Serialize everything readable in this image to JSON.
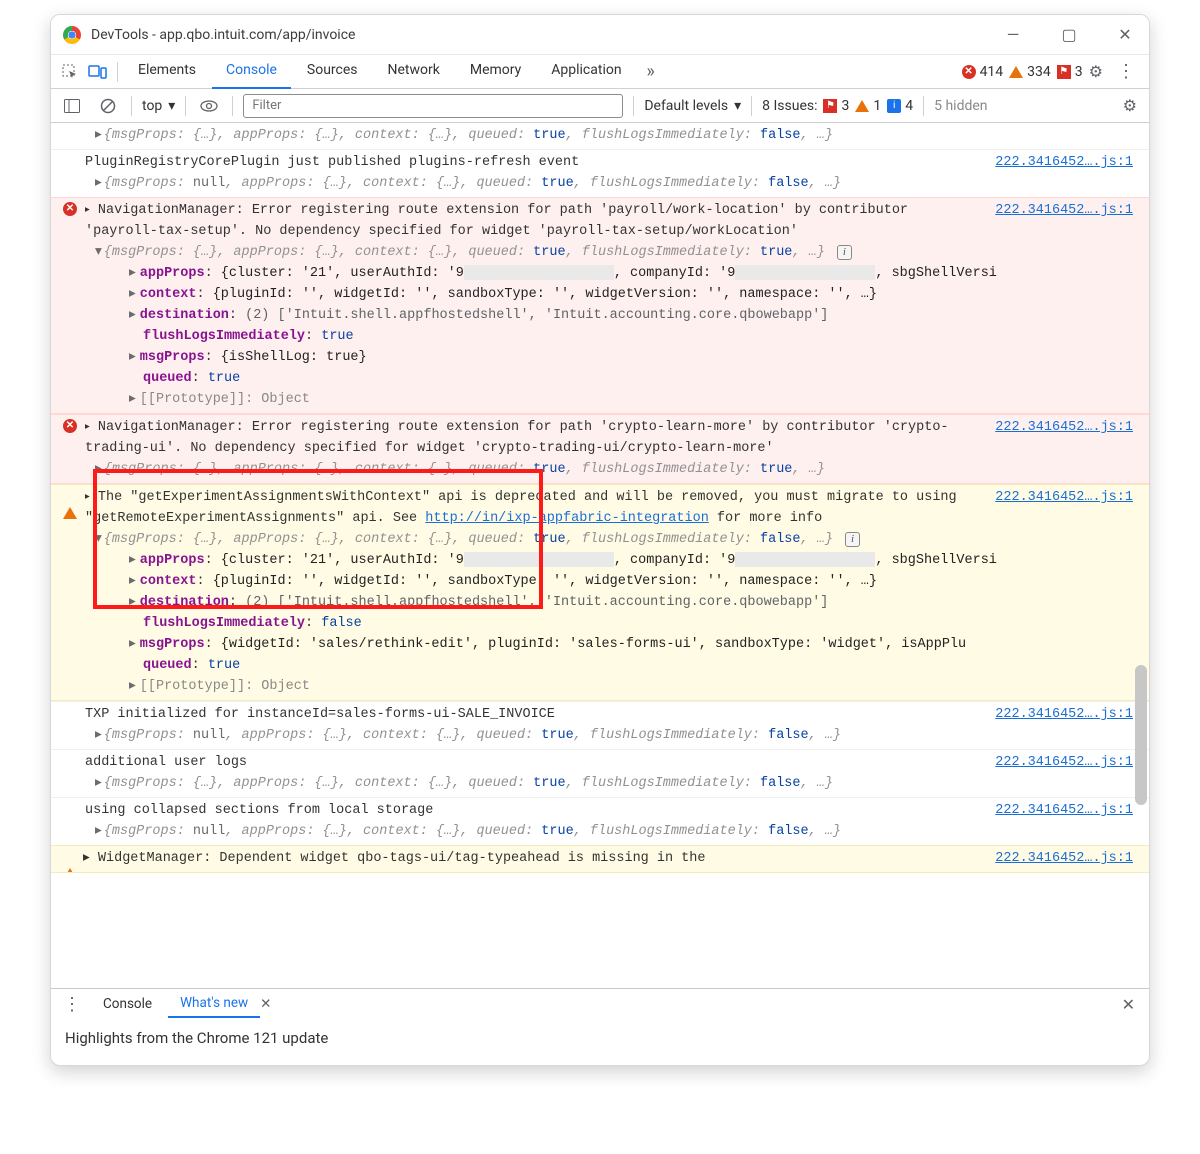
{
  "window": {
    "title": "DevTools - app.qbo.intuit.com/app/invoice"
  },
  "tabs": {
    "items": [
      "Elements",
      "Console",
      "Sources",
      "Network",
      "Memory",
      "Application"
    ],
    "active": "Console",
    "error_count": "414",
    "warn_count": "334",
    "flag_count": "3"
  },
  "toolbar": {
    "context": "top",
    "filter_placeholder": "Filter",
    "levels": "Default levels",
    "issues_label": "8 Issues:",
    "issues_err": "3",
    "issues_warn": "1",
    "issues_info": "4",
    "hidden": "5 hidden"
  },
  "source_link": "222.3416452….js:1",
  "objLine_std": "{msgProps: {…}, appProps: {…}, context: {…}, queued: true, flushLogsImmediately: false, …}",
  "objLine_null": "{msgProps: null, appProps: {…}, context: {…}, queued: true, flushLogsImmediately: false, …}",
  "objLine_flushTrue": "{msgProps: {…}, appProps: {…}, context: {…}, queued: true, flushLogsImmediately: true, …}",
  "rows": {
    "plugin": "PluginRegistryCorePlugin just published plugins-refresh event",
    "err1": "NavigationManager: Error registering route extension for path 'payroll/work-location' by contributor 'payroll-tax-setup'. No dependency specified for widget 'payroll-tax-setup/workLocation'",
    "err2": "NavigationManager: Error registering route extension for path 'crypto-learn-more' by contributor 'crypto-trading-ui'. No dependency specified for widget 'crypto-trading-ui/crypto-learn-more'",
    "warn1_a": "The \"getExperimentAssignmentsWithContext\" api is deprecated and will be removed, you must migrate to using \"getRemoteExperimentAssignments\" api. See ",
    "warn1_link": "http://in/ixp-appfabric-integration",
    "warn1_b": " for more info",
    "txp": "TXP initialized for instanceId=sales-forms-ui-SALE_INVOICE",
    "addl": "additional user logs",
    "collapsed": "using collapsed sections from local storage",
    "widgetmgr": "WidgetManager: Dependent widget qbo-tags-ui/tag-typeahead is missing in the"
  },
  "props": {
    "appProps_line_a": "{cluster: '21', userAuthId: '9",
    "appProps_line_b": ", companyId: '9",
    "appProps_line_c": ", sbgShellVersi",
    "context_line": "{pluginId: '', widgetId: '', sandboxType: '', widgetVersion: '', namespace: '', …}",
    "destination_line": "(2) ['Intuit.shell.appfhostedshell', 'Intuit.accounting.core.qbowebapp']",
    "flush_true": "true",
    "flush_false": "false",
    "msgProps_shell": "{isShellLog: true}",
    "msgProps_widget": "{widgetId: 'sales/rethink-edit', pluginId: 'sales-forms-ui', sandboxType: 'widget', isAppPlu",
    "queued": "true",
    "proto": "[[Prototype]]: Object"
  },
  "drawer": {
    "tabs": [
      "Console",
      "What's new"
    ],
    "active": "What's new",
    "headline": "Highlights from the Chrome 121 update"
  }
}
